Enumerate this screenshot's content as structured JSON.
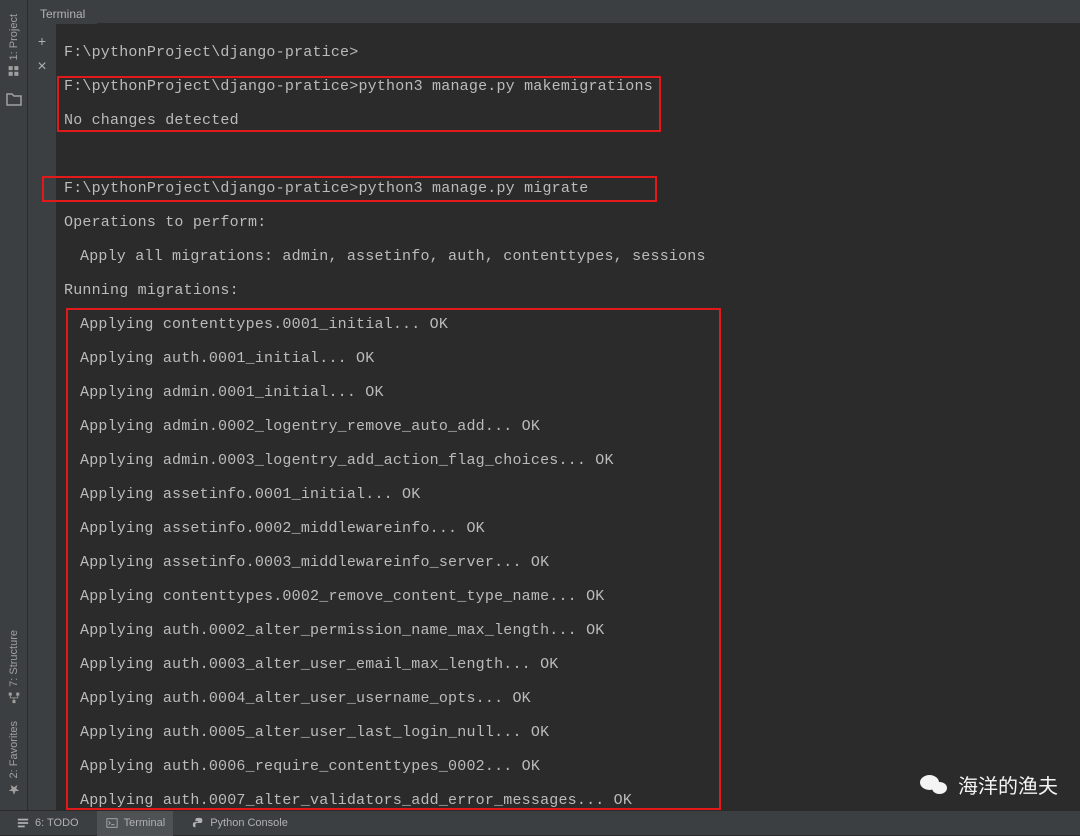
{
  "sidebar": {
    "project_tab": "1: Project",
    "structure_tab": "7: Structure",
    "favorites_tab": "2: Favorites"
  },
  "header": {
    "terminal_tab": "Terminal"
  },
  "toolbar": {
    "plus_glyph": "+",
    "close_glyph": "×"
  },
  "terminal": {
    "prompt1": "F:\\pythonProject\\django-pratice>",
    "prompt2": "F:\\pythonProject\\django-pratice>python3 manage.py makemigrations",
    "no_changes": "No changes detected",
    "prompt3": "F:\\pythonProject\\django-pratice>python3 manage.py migrate",
    "ops_header": "Operations to perform:",
    "apply_all": "Apply all migrations: admin, assetinfo, auth, contenttypes, sessions",
    "running": "Running migrations:",
    "m01": "Applying contenttypes.0001_initial... OK",
    "m02": "Applying auth.0001_initial... OK",
    "m03": "Applying admin.0001_initial... OK",
    "m04": "Applying admin.0002_logentry_remove_auto_add... OK",
    "m05": "Applying admin.0003_logentry_add_action_flag_choices... OK",
    "m06": "Applying assetinfo.0001_initial... OK",
    "m07": "Applying assetinfo.0002_middlewareinfo... OK",
    "m08": "Applying assetinfo.0003_middlewareinfo_server... OK",
    "m09": "Applying contenttypes.0002_remove_content_type_name... OK",
    "m10": "Applying auth.0002_alter_permission_name_max_length... OK",
    "m11": "Applying auth.0003_alter_user_email_max_length... OK",
    "m12": "Applying auth.0004_alter_user_username_opts... OK",
    "m13": "Applying auth.0005_alter_user_last_login_null... OK",
    "m14": "Applying auth.0006_require_contenttypes_0002... OK",
    "m15": "Applying auth.0007_alter_validators_add_error_messages... OK"
  },
  "bottom": {
    "todo": "6: TODO",
    "terminal": "Terminal",
    "python_console": "Python Console"
  },
  "watermark": "海洋的渔夫"
}
